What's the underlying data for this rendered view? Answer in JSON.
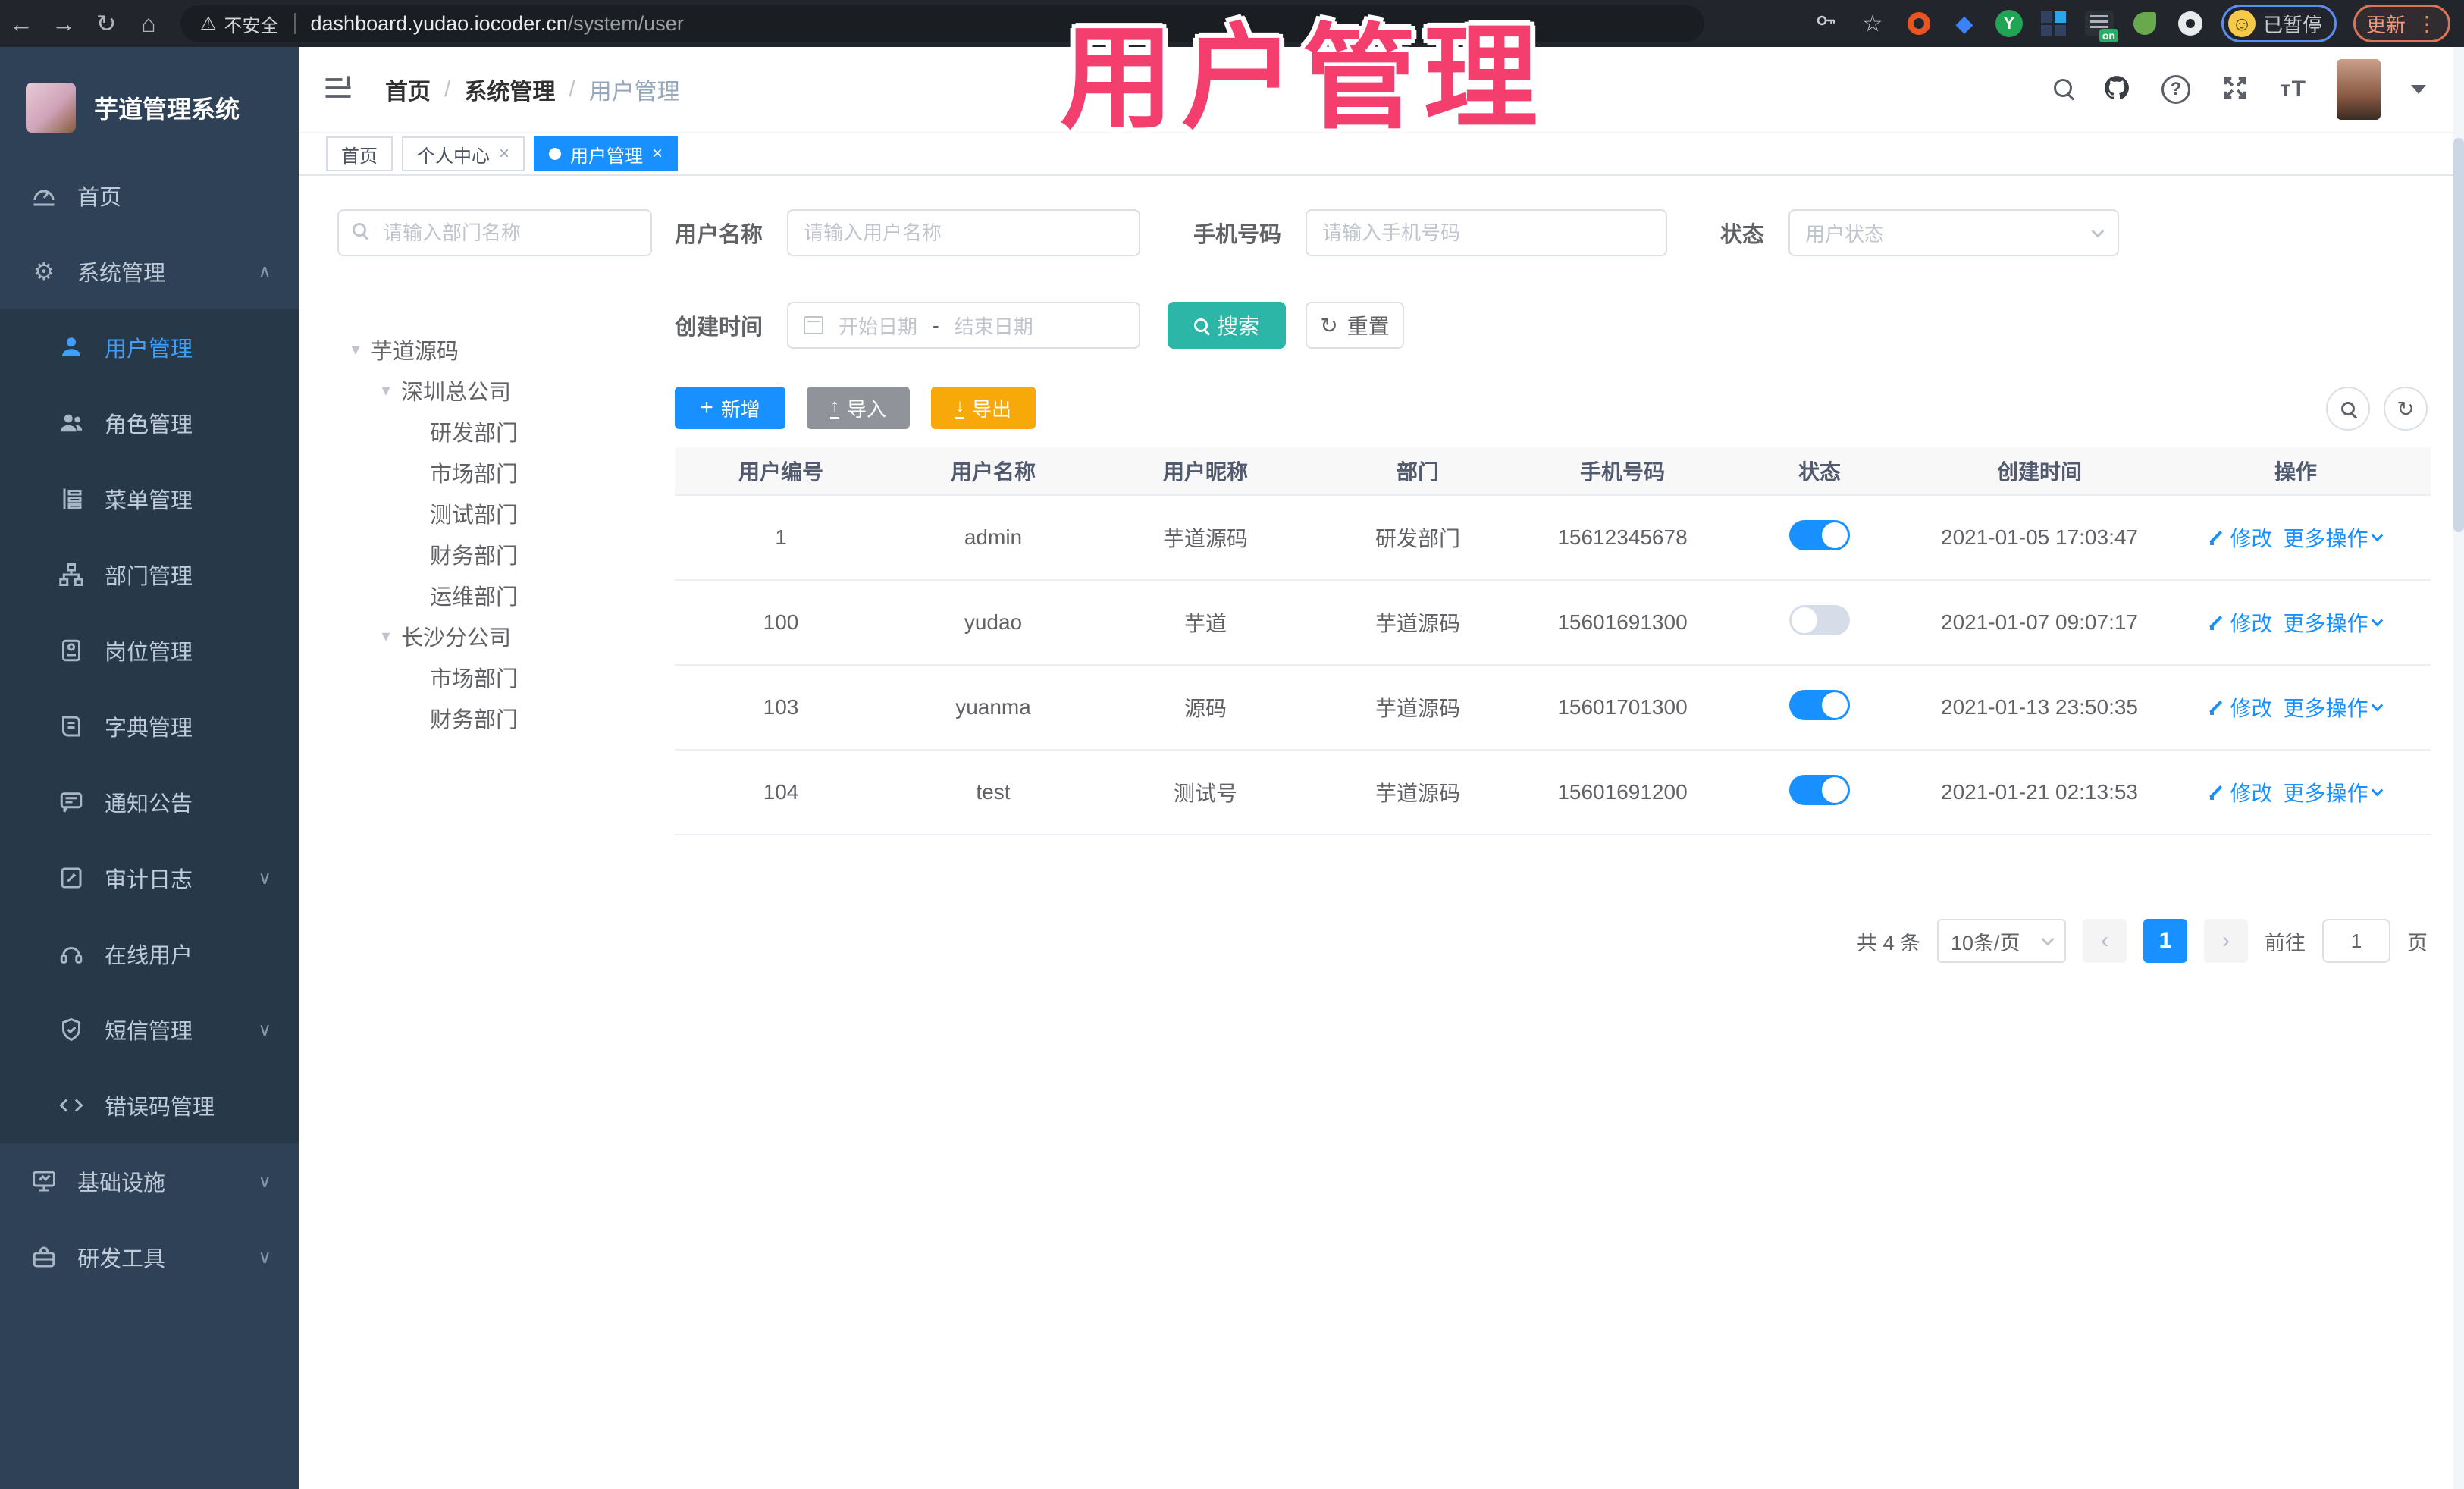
{
  "colors": {
    "primary_blue": "#1890ff",
    "active_blue": "#409eff",
    "search_teal": "#2cb6a8",
    "export_yellow": "#f7a90a",
    "import_gray": "#909399",
    "sidebar_bg": "#2f4156",
    "overlay_pink": "#f43f6e"
  },
  "overlay_title": "用户管理",
  "browser": {
    "security_label": "不安全",
    "url_host": "dashboard.yudao.iocoder.cn",
    "url_path": "/system/user",
    "extension_on_badge": "on",
    "profile_status": "已暂停",
    "update_label": "更新"
  },
  "sidebar": {
    "logo_title": "芋道管理系统",
    "items": [
      {
        "label": "首页"
      },
      {
        "label": "系统管理",
        "chevron": "∧"
      },
      {
        "label": "用户管理",
        "active": "true"
      },
      {
        "label": "角色管理"
      },
      {
        "label": "菜单管理"
      },
      {
        "label": "部门管理"
      },
      {
        "label": "岗位管理"
      },
      {
        "label": "字典管理"
      },
      {
        "label": "通知公告"
      },
      {
        "label": "审计日志",
        "chevron": "∨"
      },
      {
        "label": "在线用户"
      },
      {
        "label": "短信管理",
        "chevron": "∨"
      },
      {
        "label": "错误码管理"
      },
      {
        "label": "基础设施",
        "chevron": "∨"
      },
      {
        "label": "研发工具",
        "chevron": "∨"
      }
    ]
  },
  "header": {
    "breadcrumb": {
      "items": [
        "首页",
        "系统管理",
        "用户管理"
      ],
      "separator": "/"
    },
    "tabs": [
      {
        "label": "首页"
      },
      {
        "label": "个人中心",
        "close": "×"
      },
      {
        "label": "用户管理",
        "close": "×",
        "active": "true"
      }
    ]
  },
  "tree": {
    "search_placeholder": "请输入部门名称",
    "nodes": [
      {
        "label": "芋道源码",
        "caret": "▾"
      },
      {
        "label": "深圳总公司",
        "caret": "▾"
      },
      {
        "label": "研发部门",
        "caret": ""
      },
      {
        "label": "市场部门",
        "caret": ""
      },
      {
        "label": "测试部门",
        "caret": ""
      },
      {
        "label": "财务部门",
        "caret": ""
      },
      {
        "label": "运维部门",
        "caret": ""
      },
      {
        "label": "长沙分公司",
        "caret": "▾"
      },
      {
        "label": "市场部门",
        "caret": ""
      },
      {
        "label": "财务部门",
        "caret": ""
      }
    ]
  },
  "filters": {
    "username": {
      "label": "用户名称",
      "placeholder": "请输入用户名称"
    },
    "mobile": {
      "label": "手机号码",
      "placeholder": "请输入手机号码"
    },
    "status": {
      "label": "状态",
      "placeholder": "用户状态"
    },
    "create_time": {
      "label": "创建时间",
      "start_placeholder": "开始日期",
      "separator": "-",
      "end_placeholder": "结束日期"
    },
    "search_label": "搜索",
    "reset_label": "重置"
  },
  "toolbar": {
    "add_label": "新增",
    "import_label": "导入",
    "export_label": "导出"
  },
  "table": {
    "columns": [
      "用户编号",
      "用户名称",
      "用户昵称",
      "部门",
      "手机号码",
      "状态",
      "创建时间",
      "操作"
    ],
    "actions": {
      "edit": "修改",
      "more": "更多操作"
    },
    "rows": [
      {
        "id": "1",
        "username": "admin",
        "nickname": "芋道源码",
        "dept": "研发部门",
        "mobile": "15612345678",
        "status_state": "on",
        "created": "2021-01-05 17:03:47"
      },
      {
        "id": "100",
        "username": "yudao",
        "nickname": "芋道",
        "dept": "芋道源码",
        "mobile": "15601691300",
        "status_state": "off",
        "created": "2021-01-07 09:07:17"
      },
      {
        "id": "103",
        "username": "yuanma",
        "nickname": "源码",
        "dept": "芋道源码",
        "mobile": "15601701300",
        "status_state": "on",
        "created": "2021-01-13 23:50:35"
      },
      {
        "id": "104",
        "username": "test",
        "nickname": "测试号",
        "dept": "芋道源码",
        "mobile": "15601691200",
        "status_state": "on",
        "created": "2021-01-21 02:13:53"
      }
    ]
  },
  "pagination": {
    "total": "共 4 条",
    "page_size": "10条/页",
    "prev": "‹",
    "current": "1",
    "next": "›",
    "goto_label": "前往",
    "goto_value": "1",
    "page_label": "页"
  }
}
